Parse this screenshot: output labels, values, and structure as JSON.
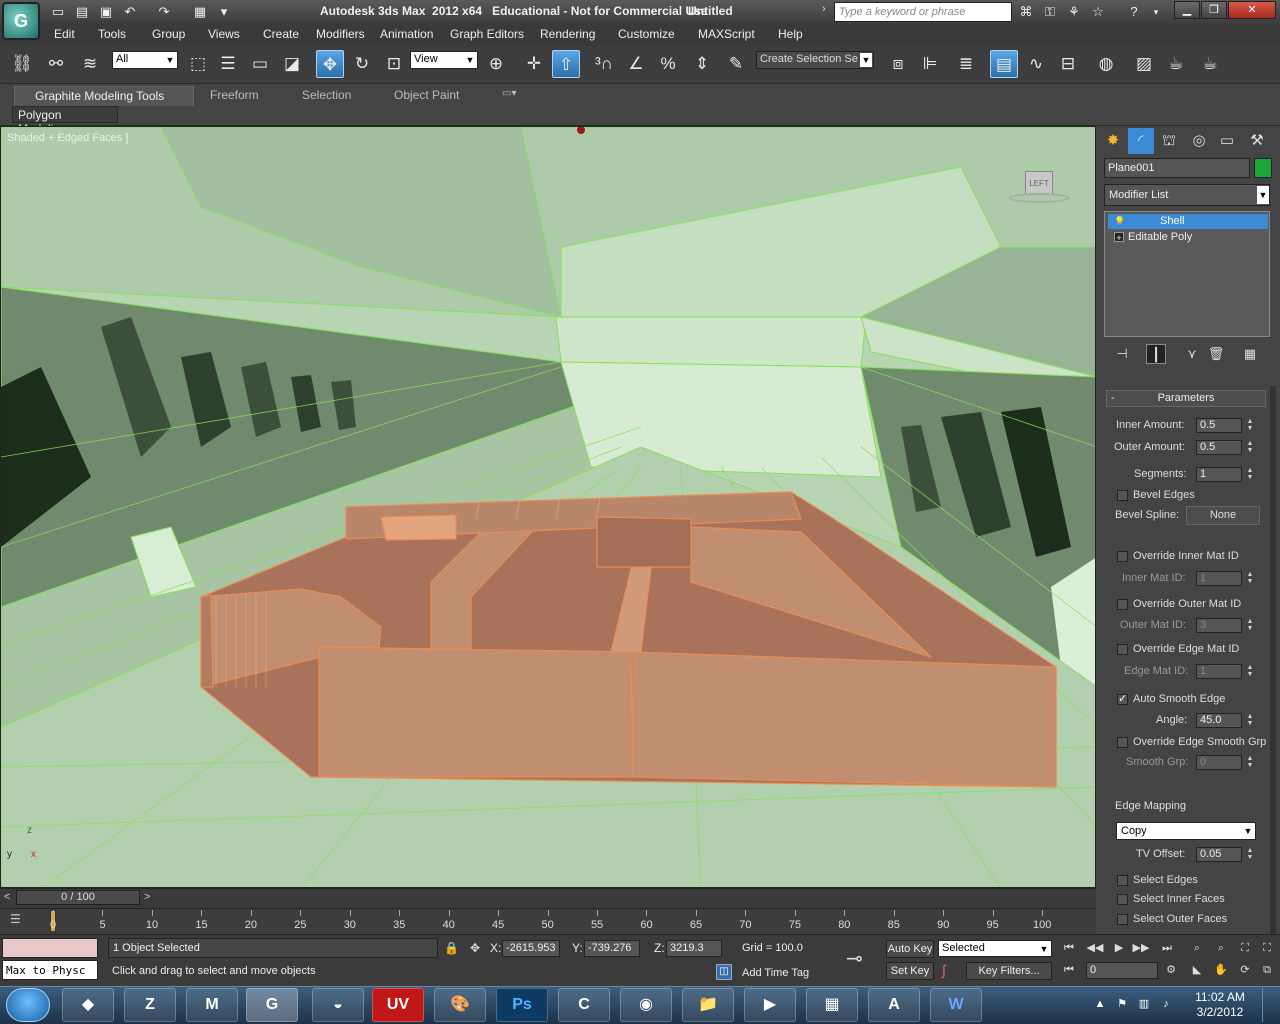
{
  "title": {
    "app": "Autodesk 3ds Max  2012 x64   Educational - Not for Commercial Use",
    "doc": "Untitled",
    "search_placeholder": "Type a keyword or phrase",
    "logo": "G"
  },
  "menu": [
    "Edit",
    "Tools",
    "Group",
    "Views",
    "Create",
    "Modifiers",
    "Animation",
    "Graph Editors",
    "Rendering",
    "Customize",
    "MAXScript",
    "Help"
  ],
  "toolbar": {
    "selection_filter": "All",
    "ref_coord": "View",
    "named_selection": "Create Selection Se"
  },
  "ribbon": {
    "tabs": [
      "Graphite Modeling Tools",
      "Freeform",
      "Selection",
      "Object Paint"
    ],
    "panel": "Polygon Modeling"
  },
  "viewport": {
    "label": "Shaded + Edged Faces ]",
    "viewcube": "LEFT",
    "axis_z": "z",
    "axis_y": "y",
    "axis_x": "x",
    "bg_color": "#b7d4b3",
    "object_color": "#c18f6f"
  },
  "command_panel": {
    "object_name": "Plane001",
    "object_color": "#1ea63a",
    "modifier_list": "Modifier List",
    "stack": [
      "Shell",
      "Editable Poly"
    ],
    "rollout_title": "Parameters",
    "inner_amount_label": "Inner Amount:",
    "inner_amount": "0.5",
    "outer_amount_label": "Outer Amount:",
    "outer_amount": "0.5",
    "segments_label": "Segments:",
    "segments": "1",
    "bevel_edges": "Bevel Edges",
    "bevel_spline_label": "Bevel Spline:",
    "bevel_spline": "None",
    "override_inner": "Override Inner Mat ID",
    "inner_mat_label": "Inner Mat ID:",
    "inner_mat": "1",
    "override_outer": "Override Outer Mat ID",
    "outer_mat_label": "Outer Mat ID:",
    "outer_mat": "3",
    "override_edge": "Override Edge Mat ID",
    "edge_mat_label": "Edge Mat ID:",
    "edge_mat": "1",
    "auto_smooth": "Auto Smooth Edge",
    "angle_label": "Angle:",
    "angle": "45.0",
    "override_smooth": "Override Edge Smooth Grp",
    "smooth_grp_label": "Smooth Grp:",
    "smooth_grp": "0",
    "edge_mapping_label": "Edge Mapping",
    "edge_mapping": "Copy",
    "tv_offset_label": "TV Offset:",
    "tv_offset": "0.05",
    "select_edges": "Select Edges",
    "select_inner": "Select Inner Faces",
    "select_outer": "Select Outer Faces"
  },
  "timeline": {
    "frame_display": "0 / 100",
    "ticks": [
      "0",
      "5",
      "10",
      "15",
      "20",
      "25",
      "30",
      "35",
      "40",
      "45",
      "50",
      "55",
      "60",
      "65",
      "70",
      "75",
      "80",
      "85",
      "90",
      "95",
      "100"
    ]
  },
  "status": {
    "listener": "Max to Physc",
    "selection": "1 Object Selected",
    "prompt": "Click and drag to select and move objects",
    "x_label": "X:",
    "x": "-2615.953",
    "y_label": "Y:",
    "y": "-739.276",
    "z_label": "Z:",
    "z": "3219.3",
    "grid": "Grid = 100.0",
    "add_time_tag": "Add Time Tag",
    "auto_key": "Auto Key",
    "set_key": "Set Key",
    "key_mode": "Selected",
    "key_filters": "Key Filters...",
    "frame": "0"
  },
  "taskbar": {
    "apps": [
      "Unity",
      "ZBrush",
      "Maya",
      "3ds Max",
      "Mudbox",
      "UVLayout",
      "Painter",
      "Photoshop",
      "Camtasia",
      "Chrome",
      "Explorer",
      "Player",
      "Calculator",
      "WordPad",
      "Word"
    ],
    "time": "11:02 AM",
    "date": "3/2/2012"
  }
}
